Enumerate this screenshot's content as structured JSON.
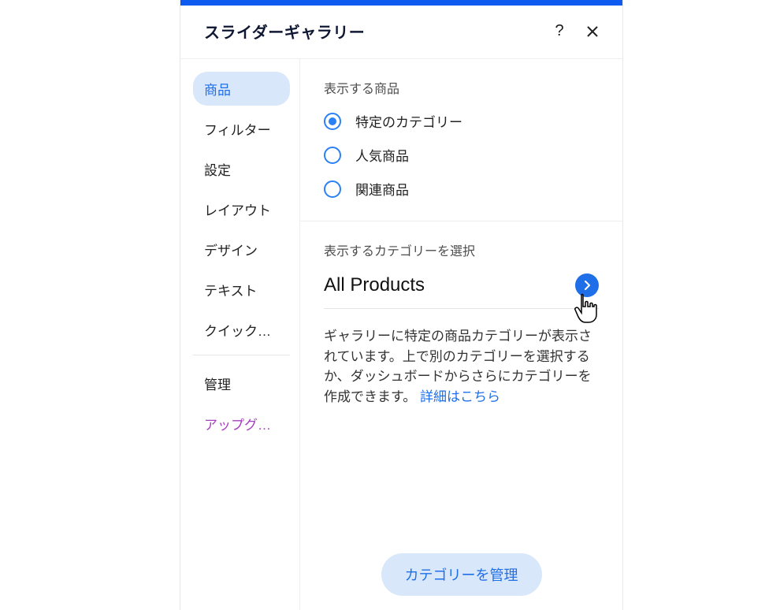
{
  "header": {
    "title": "スライダーギャラリー"
  },
  "sidebar": {
    "items": [
      {
        "label": "商品",
        "active": true
      },
      {
        "label": "フィルター"
      },
      {
        "label": "設定"
      },
      {
        "label": "レイアウト"
      },
      {
        "label": "デザイン"
      },
      {
        "label": "テキスト"
      },
      {
        "label": "クイック…"
      }
    ],
    "manage_label": "管理",
    "upgrade_label": "アップグ…"
  },
  "main": {
    "show_products_label": "表示する商品",
    "radios": [
      {
        "label": "特定のカテゴリー",
        "selected": true
      },
      {
        "label": "人気商品",
        "selected": false
      },
      {
        "label": "関連商品",
        "selected": false
      }
    ],
    "select_category_label": "表示するカテゴリーを選択",
    "selected_category": "All Products",
    "description_text": "ギャラリーに特定の商品カテゴリーが表示されています。上で別のカテゴリーを選択するか、ダッシュボードからさらにカテゴリーを作成できます。",
    "description_link": "詳細はこちら",
    "manage_button": "カテゴリーを管理"
  }
}
